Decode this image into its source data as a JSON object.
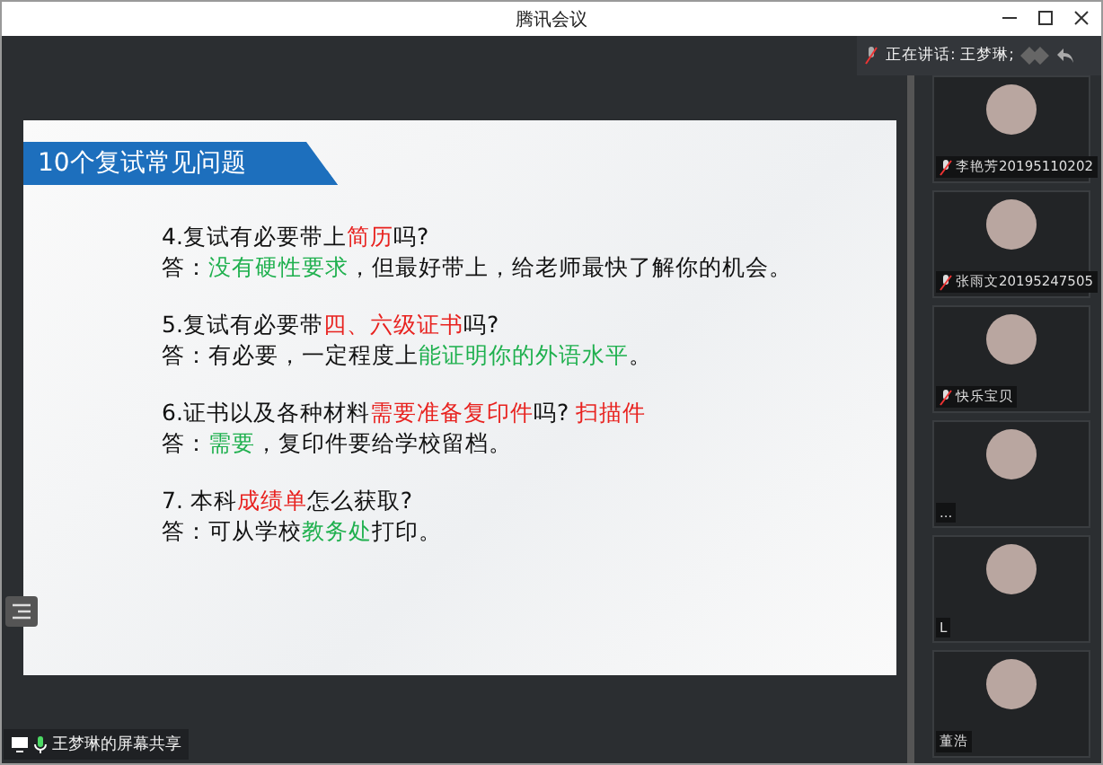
{
  "window": {
    "title": "腾讯会议"
  },
  "speaker": {
    "label": "正在讲话: 王梦琳;"
  },
  "slide": {
    "title": "10个复试常见问题",
    "qa": [
      {
        "question": [
          {
            "text": "4.复试有必要带上",
            "color": "#111111"
          },
          {
            "text": "简历",
            "color": "#e8221f"
          },
          {
            "text": "吗?",
            "color": "#111111"
          }
        ],
        "answer": [
          {
            "text": "答：",
            "color": "#111111"
          },
          {
            "text": "没有硬性要求",
            "color": "#1fb04e"
          },
          {
            "text": "，但最好带上，给老师最快了解你的机会。",
            "color": "#111111"
          }
        ]
      },
      {
        "question": [
          {
            "text": "5.复试有必要带",
            "color": "#111111"
          },
          {
            "text": "四、六级证书",
            "color": "#e8221f"
          },
          {
            "text": "吗?",
            "color": "#111111"
          }
        ],
        "answer": [
          {
            "text": "答：有必要，一定程度上",
            "color": "#111111"
          },
          {
            "text": "能证明你的外语水平",
            "color": "#1fb04e"
          },
          {
            "text": "。",
            "color": "#111111"
          }
        ]
      },
      {
        "question": [
          {
            "text": "6.证书以及各种材料",
            "color": "#111111"
          },
          {
            "text": "需要准备复印件",
            "color": "#e8221f"
          },
          {
            "text": "吗?  ",
            "color": "#111111"
          },
          {
            "text": "扫描件",
            "color": "#e8221f"
          }
        ],
        "answer": [
          {
            "text": "答：",
            "color": "#111111"
          },
          {
            "text": "需要",
            "color": "#1fb04e"
          },
          {
            "text": "，复印件要给学校留档。",
            "color": "#111111"
          }
        ]
      },
      {
        "question": [
          {
            "text": "7. 本科",
            "color": "#111111"
          },
          {
            "text": "成绩单",
            "color": "#e8221f"
          },
          {
            "text": "怎么获取?",
            "color": "#111111"
          }
        ],
        "answer": [
          {
            "text": "答：可从学校",
            "color": "#111111"
          },
          {
            "text": "教务处",
            "color": "#1fb04e"
          },
          {
            "text": "打印。",
            "color": "#111111"
          }
        ]
      }
    ]
  },
  "participants": [
    {
      "name": "李艳芳20195110202",
      "muted": true
    },
    {
      "name": "张雨文20195247505",
      "muted": true
    },
    {
      "name": "快乐宝贝",
      "muted": true
    },
    {
      "name": "...",
      "muted": false
    },
    {
      "name": "L",
      "muted": false
    },
    {
      "name": "董浩",
      "muted": false
    }
  ],
  "status_bar": {
    "label": "王梦琳的屏幕共享"
  }
}
